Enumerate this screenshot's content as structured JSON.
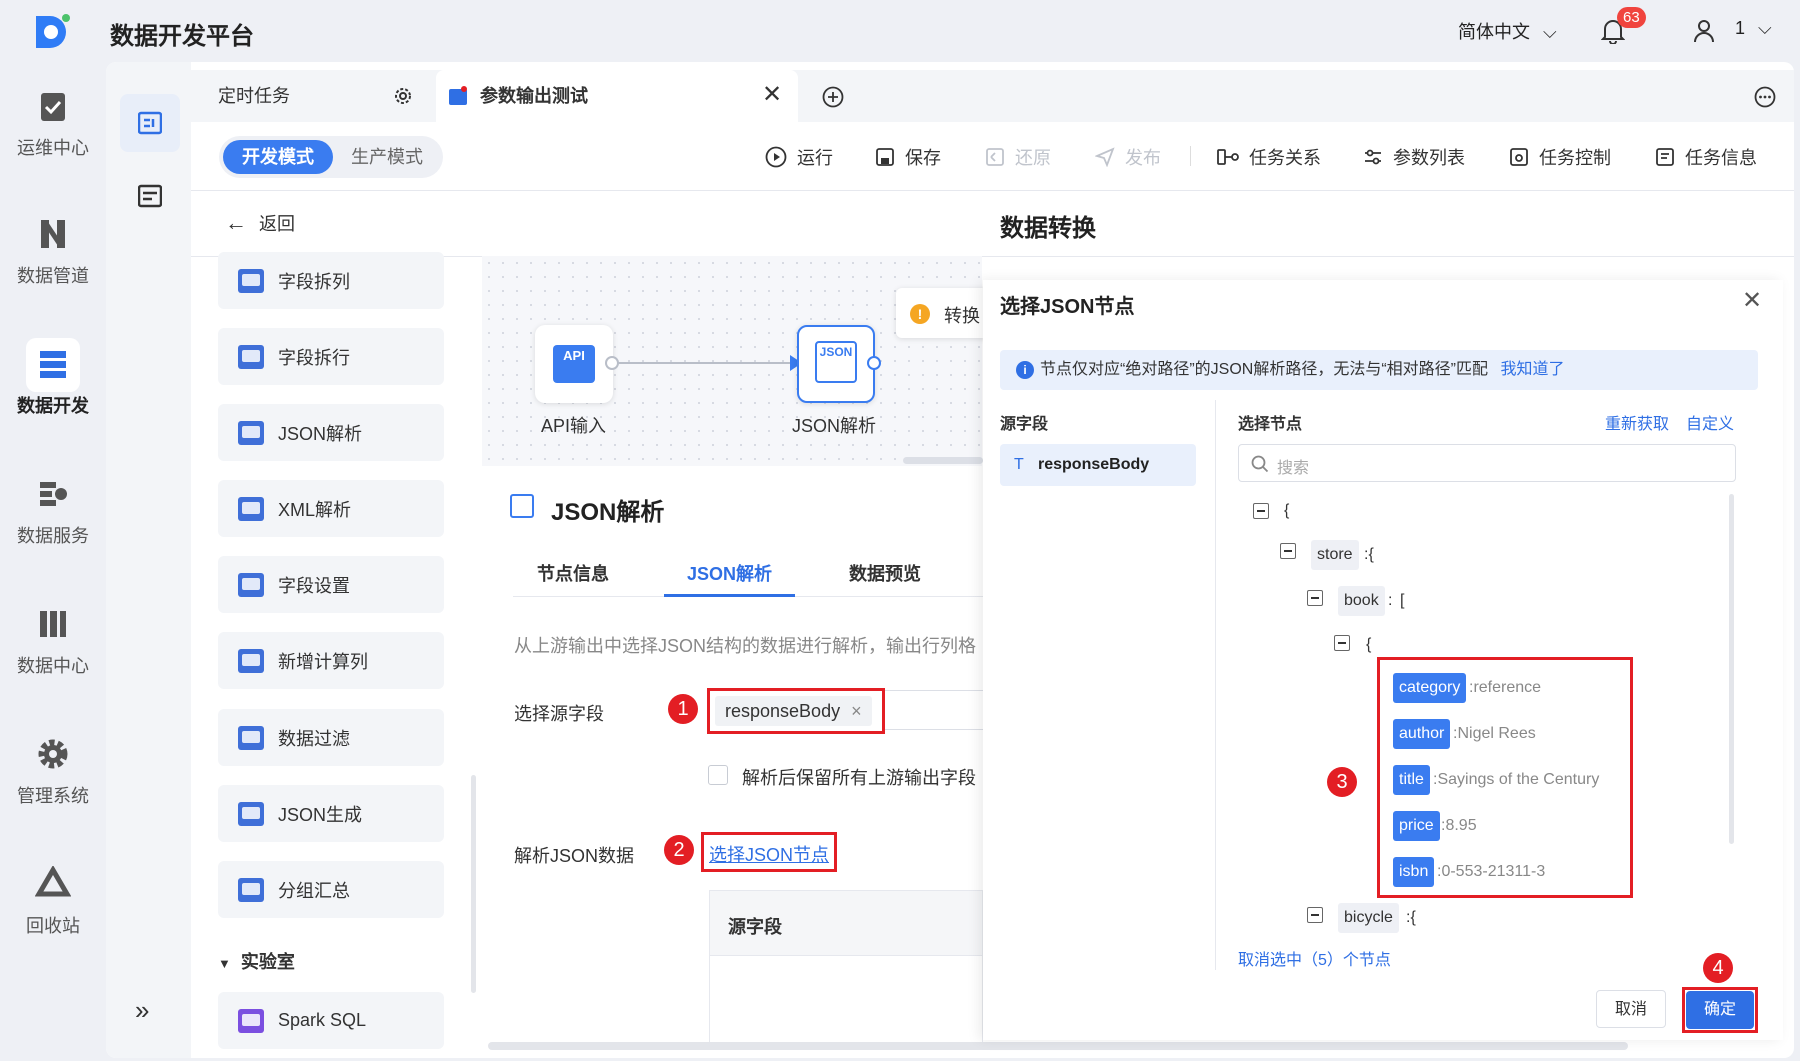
{
  "app": {
    "title": "数据开发平台"
  },
  "topbar": {
    "language": "简体中文",
    "notification_count": "63",
    "user": "1"
  },
  "nav": {
    "items": [
      {
        "label": "运维中心",
        "icon": "clipboard-check-icon"
      },
      {
        "label": "数据管道",
        "icon": "pipeline-icon"
      },
      {
        "label": "数据开发",
        "icon": "data-dev-icon",
        "active": true
      },
      {
        "label": "数据服务",
        "icon": "data-service-icon"
      },
      {
        "label": "数据中心",
        "icon": "data-center-icon"
      },
      {
        "label": "管理系统",
        "icon": "gear-icon"
      },
      {
        "label": "回收站",
        "icon": "recycle-icon"
      }
    ],
    "expand": "»"
  },
  "tabs": [
    {
      "label": "定时任务"
    },
    {
      "label": "参数输出测试"
    }
  ],
  "mode": {
    "dev": "开发模式",
    "prod": "生产模式"
  },
  "toolbar": {
    "run": "运行",
    "save": "保存",
    "restore": "还原",
    "publish": "发布",
    "relations": "任务关系",
    "params": "参数列表",
    "control": "任务控制",
    "info": "任务信息"
  },
  "back": "返回",
  "page_title": "数据转换",
  "components": [
    "字段拆列",
    "字段拆行",
    "JSON解析",
    "XML解析",
    "字段设置",
    "新增计算列",
    "数据过滤",
    "JSON生成",
    "分组汇总"
  ],
  "lab": {
    "title": "实验室",
    "items": [
      "Spark SQL"
    ]
  },
  "canvas": {
    "node1": {
      "label": "API输入",
      "badge": "API"
    },
    "node2": {
      "label": "JSON解析",
      "badge": "JSON"
    },
    "tooltip": "转换"
  },
  "panel": {
    "title": "JSON解析",
    "tabs": [
      "节点信息",
      "JSON解析",
      "数据预览"
    ],
    "description": "从上游输出中选择JSON结构的数据进行解析，输出行列格",
    "source_label": "选择源字段",
    "source_value": "responseBody",
    "keep_label": "解析后保留所有上游输出字段",
    "parse_label": "解析JSON数据",
    "select_link": "选择JSON节点",
    "table_header": "源字段"
  },
  "markers": [
    "1",
    "2",
    "3",
    "4"
  ],
  "dialog": {
    "title": "选择JSON节点",
    "notice": "节点仅对应“绝对路径”的JSON解析路径，无法与“相对路径”匹配",
    "notice_link": "我知道了",
    "source_header": "源字段",
    "source_item": "responseBody",
    "node_header": "选择节点",
    "refresh": "重新获取",
    "custom": "自定义",
    "search_placeholder": "搜索",
    "tree": {
      "root": "{",
      "store": "store",
      "book": "book",
      "book_open": "[",
      "item_open": "{",
      "fields": [
        {
          "key": "category",
          "value": "reference"
        },
        {
          "key": "author",
          "value": "Nigel Rees"
        },
        {
          "key": "title",
          "value": "Sayings of the Century"
        },
        {
          "key": "price",
          "value": "8.95"
        },
        {
          "key": "isbn",
          "value": "0-553-21311-3"
        }
      ],
      "bicycle": "bicycle"
    },
    "deselect": "取消选中（5）个节点",
    "cancel": "取消",
    "confirm": "确定"
  },
  "colors": {
    "primary": "#3a7cf0",
    "marker": "#e31e24"
  }
}
